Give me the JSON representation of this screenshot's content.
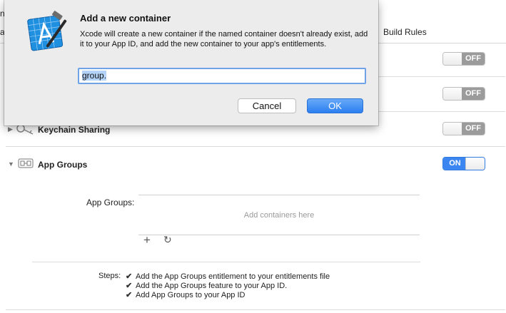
{
  "background": {
    "top_left_fragment": "n",
    "tab_left_fragment": "a",
    "build_rules_tab": "Build Rules",
    "capabilities": [
      {
        "name": "",
        "state": "OFF"
      },
      {
        "name": "",
        "state": "OFF"
      },
      {
        "name": "Keychain Sharing",
        "state": "OFF"
      },
      {
        "name": "App Groups",
        "state": "ON"
      }
    ],
    "app_groups": {
      "label": "App Groups:",
      "placeholder": "Add containers here",
      "add_icon": "plus-icon",
      "refresh_icon": "refresh-icon"
    },
    "steps": {
      "label": "Steps:",
      "items": [
        "Add the App Groups entitlement to your entitlements file",
        "Add the App Groups feature to your App ID.",
        "Add App Groups to your App ID"
      ]
    }
  },
  "dialog": {
    "icon": "xcode-icon",
    "title": "Add a new container",
    "message": "Xcode will create a new container if the named container doesn't already exist, add it to your App ID, and add the new container to your app's entitlements.",
    "input_value": "group.",
    "cancel_label": "Cancel",
    "ok_label": "OK"
  },
  "colors": {
    "accent": "#3b86f0",
    "toggle_off": "#9b9b9b",
    "sheet_bg": "#ececec"
  }
}
